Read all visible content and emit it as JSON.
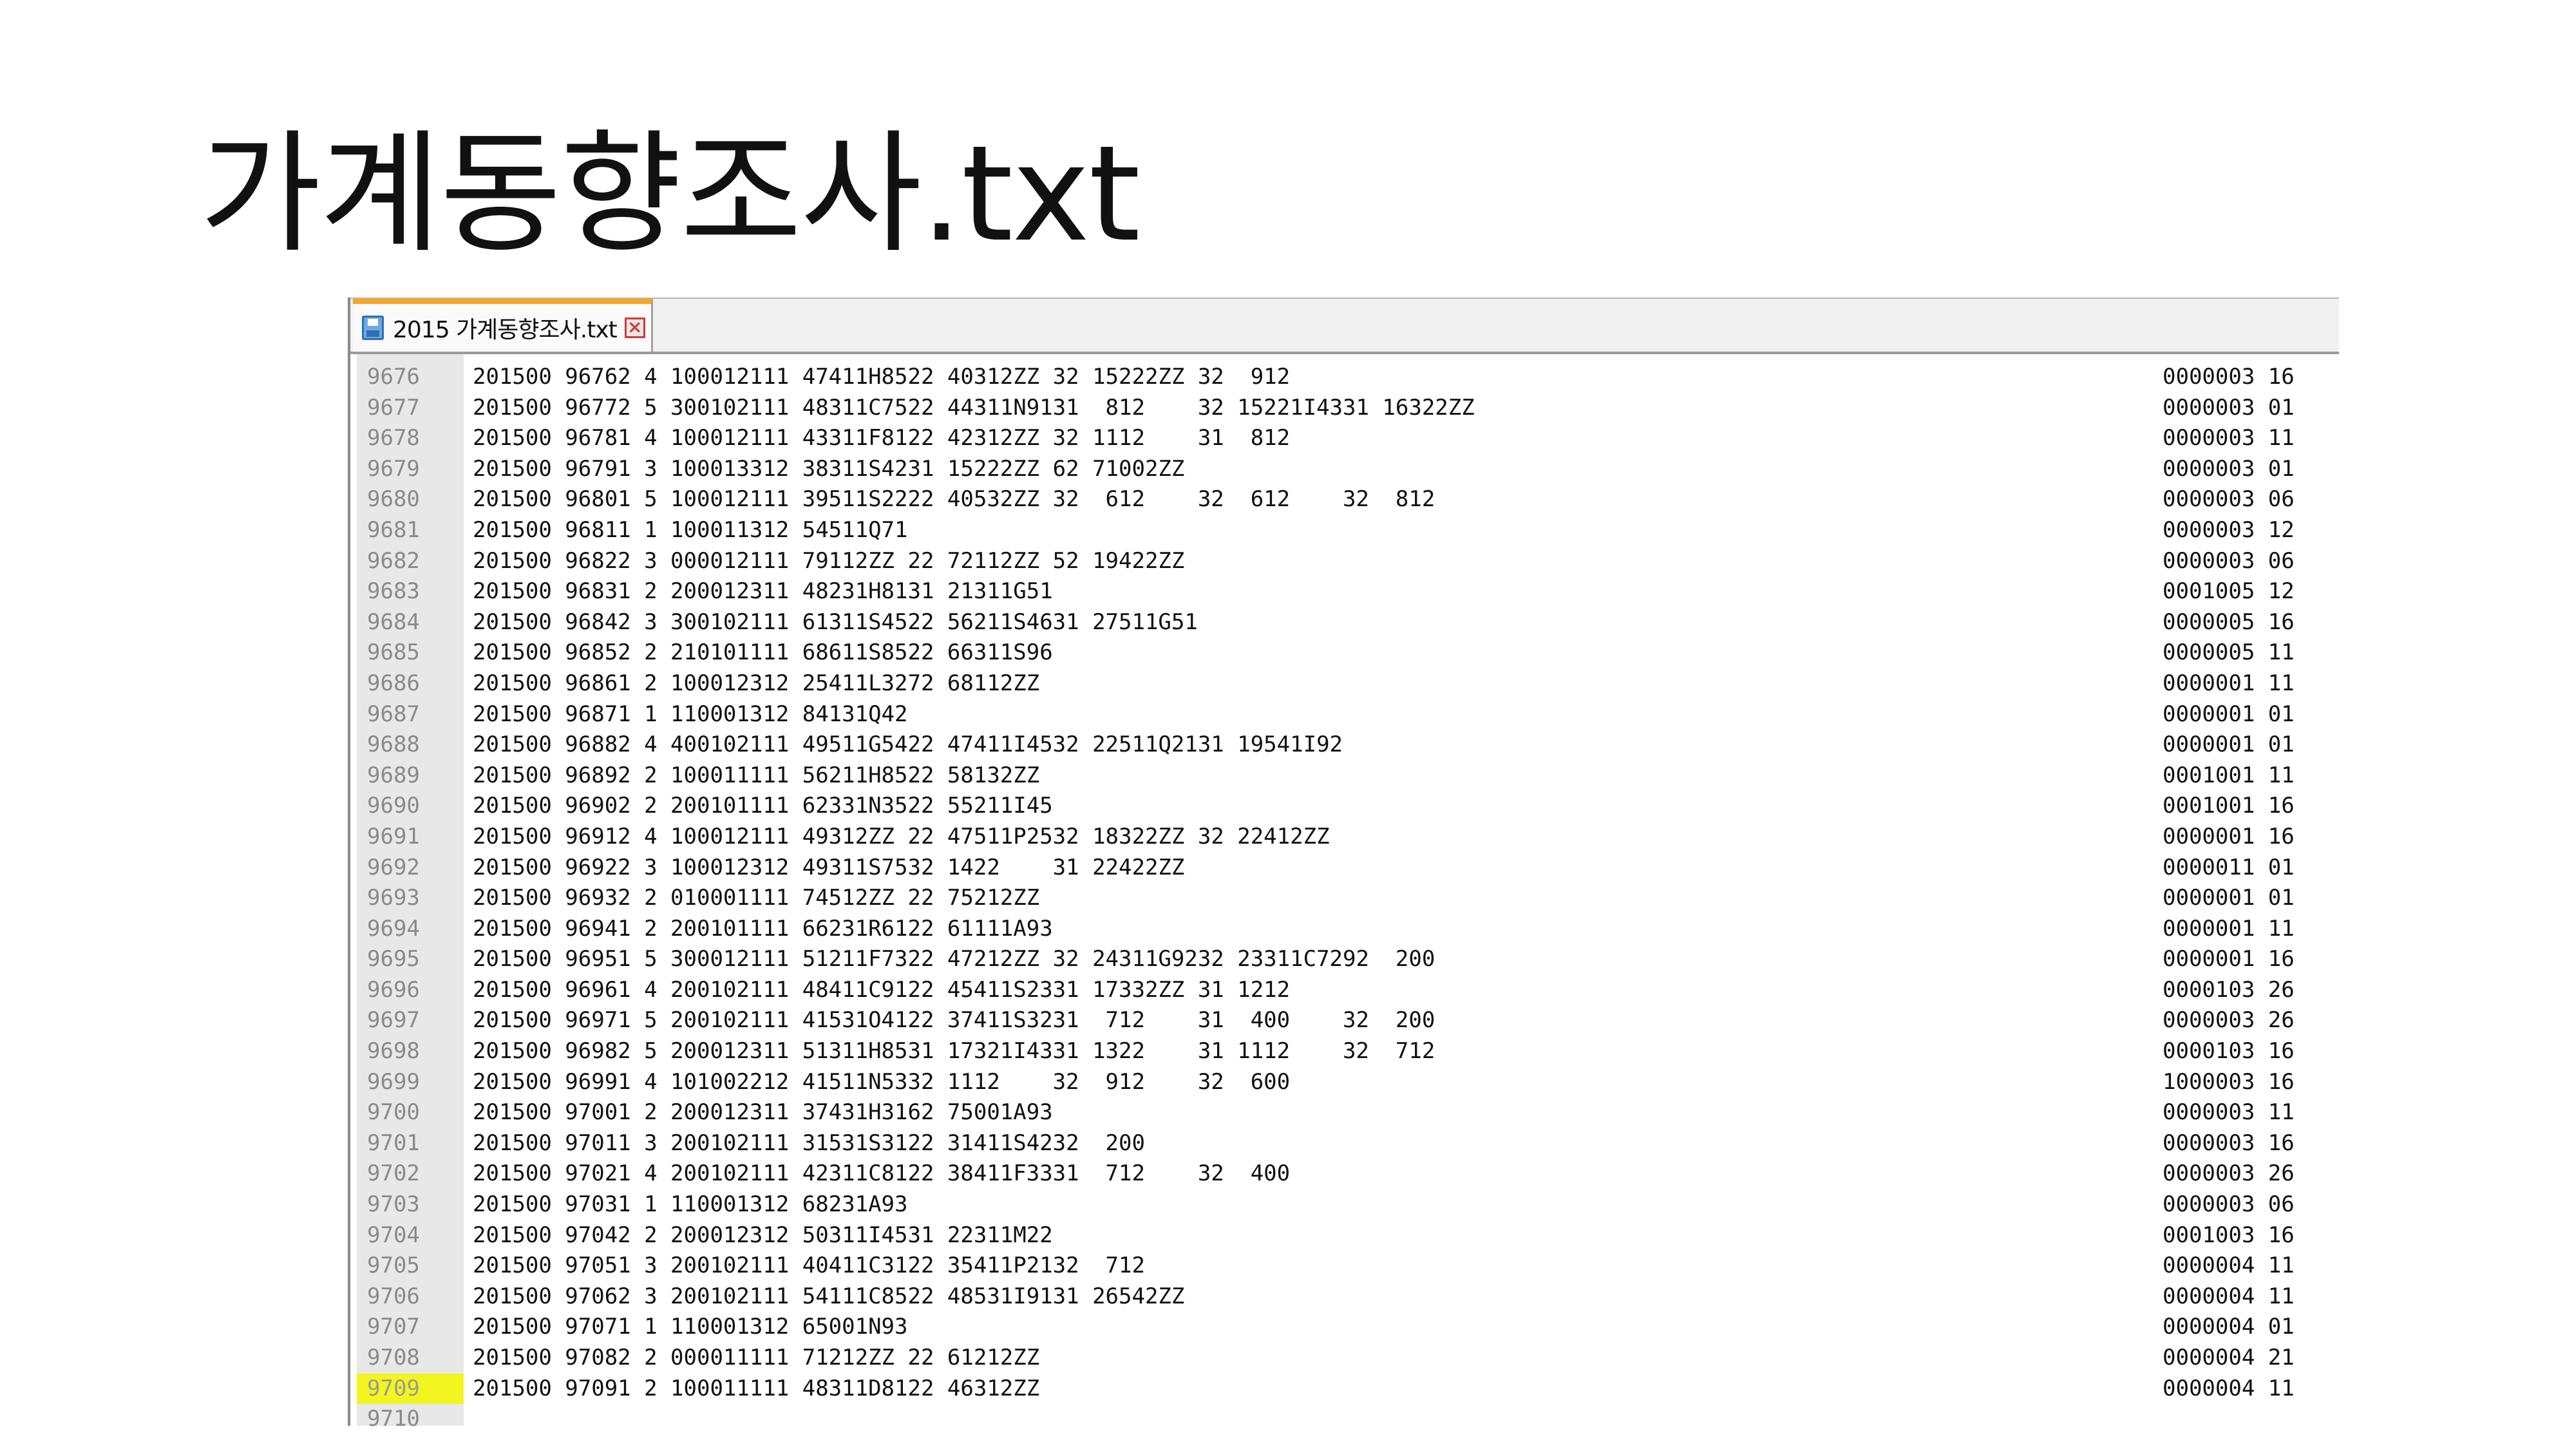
{
  "slide": {
    "title": "가계동향조사.txt"
  },
  "tab": {
    "label": "2015 가계동향조사.txt",
    "icon": "save-icon",
    "close_icon": "close-icon"
  },
  "highlight_color": "#f2f520",
  "lines": [
    {
      "n": "9676",
      "text": "201500 96762 4 100012111 47411H8522 40312ZZ 32 15222ZZ 32  912",
      "tail": "0000003 16"
    },
    {
      "n": "9677",
      "text": "201500 96772 5 300102111 48311C7522 44311N9131  812    32 15221I4331 16322ZZ",
      "tail": "0000003 01"
    },
    {
      "n": "9678",
      "text": "201500 96781 4 100012111 43311F8122 42312ZZ 32 1112    31  812",
      "tail": "0000003 11"
    },
    {
      "n": "9679",
      "text": "201500 96791 3 100013312 38311S4231 15222ZZ 62 71002ZZ",
      "tail": "0000003 01"
    },
    {
      "n": "9680",
      "text": "201500 96801 5 100012111 39511S2222 40532ZZ 32  612    32  612    32  812",
      "tail": "0000003 06"
    },
    {
      "n": "9681",
      "text": "201500 96811 1 100011312 54511Q71",
      "tail": "0000003 12"
    },
    {
      "n": "9682",
      "text": "201500 96822 3 000012111 79112ZZ 22 72112ZZ 52 19422ZZ",
      "tail": "0000003 06"
    },
    {
      "n": "9683",
      "text": "201500 96831 2 200012311 48231H8131 21311G51",
      "tail": "0001005 12"
    },
    {
      "n": "9684",
      "text": "201500 96842 3 300102111 61311S4522 56211S4631 27511G51",
      "tail": "0000005 16"
    },
    {
      "n": "9685",
      "text": "201500 96852 2 210101111 68611S8522 66311S96",
      "tail": "0000005 11"
    },
    {
      "n": "9686",
      "text": "201500 96861 2 100012312 25411L3272 68112ZZ",
      "tail": "0000001 11"
    },
    {
      "n": "9687",
      "text": "201500 96871 1 110001312 84131Q42",
      "tail": "0000001 01"
    },
    {
      "n": "9688",
      "text": "201500 96882 4 400102111 49511G5422 47411I4532 22511Q2131 19541I92",
      "tail": "0000001 01"
    },
    {
      "n": "9689",
      "text": "201500 96892 2 100011111 56211H8522 58132ZZ",
      "tail": "0001001 11"
    },
    {
      "n": "9690",
      "text": "201500 96902 2 200101111 62331N3522 55211I45",
      "tail": "0001001 16"
    },
    {
      "n": "9691",
      "text": "201500 96912 4 100012111 49312ZZ 22 47511P2532 18322ZZ 32 22412ZZ",
      "tail": "0000001 16"
    },
    {
      "n": "9692",
      "text": "201500 96922 3 100012312 49311S7532 1422    31 22422ZZ",
      "tail": "0000011 01"
    },
    {
      "n": "9693",
      "text": "201500 96932 2 010001111 74512ZZ 22 75212ZZ",
      "tail": "0000001 01"
    },
    {
      "n": "9694",
      "text": "201500 96941 2 200101111 66231R6122 61111A93",
      "tail": "0000001 11"
    },
    {
      "n": "9695",
      "text": "201500 96951 5 300012111 51211F7322 47212ZZ 32 24311G9232 23311C7292  200",
      "tail": "0000001 16"
    },
    {
      "n": "9696",
      "text": "201500 96961 4 200102111 48411C9122 45411S2331 17332ZZ 31 1212",
      "tail": "0000103 26"
    },
    {
      "n": "9697",
      "text": "201500 96971 5 200102111 41531O4122 37411S3231  712    31  400    32  200",
      "tail": "0000003 26"
    },
    {
      "n": "9698",
      "text": "201500 96982 5 200012311 51311H8531 17321I4331 1322    31 1112    32  712",
      "tail": "0000103 16"
    },
    {
      "n": "9699",
      "text": "201500 96991 4 101002212 41511N5332 1112    32  912    32  600",
      "tail": "1000003 16"
    },
    {
      "n": "9700",
      "text": "201500 97001 2 200012311 37431H3162 75001A93",
      "tail": "0000003 11"
    },
    {
      "n": "9701",
      "text": "201500 97011 3 200102111 31531S3122 31411S4232  200",
      "tail": "0000003 16"
    },
    {
      "n": "9702",
      "text": "201500 97021 4 200102111 42311C8122 38411F3331  712    32  400",
      "tail": "0000003 26"
    },
    {
      "n": "9703",
      "text": "201500 97031 1 110001312 68231A93",
      "tail": "0000003 06"
    },
    {
      "n": "9704",
      "text": "201500 97042 2 200012312 50311I4531 22311M22",
      "tail": "0001003 16"
    },
    {
      "n": "9705",
      "text": "201500 97051 3 200102111 40411C3122 35411P2132  712",
      "tail": "0000004 11"
    },
    {
      "n": "9706",
      "text": "201500 97062 3 200102111 54111C8522 48531I9131 26542ZZ",
      "tail": "0000004 11"
    },
    {
      "n": "9707",
      "text": "201500 97071 1 110001312 65001N93",
      "tail": "0000004 01"
    },
    {
      "n": "9708",
      "text": "201500 97082 2 000011111 71212ZZ 22 61212ZZ",
      "tail": "0000004 21"
    },
    {
      "n": "9709",
      "text": "201500 97091 2 100011111 48311D8122 46312ZZ",
      "tail": "0000004 11",
      "highlight": true
    },
    {
      "n": "9710",
      "text": "",
      "tail": ""
    }
  ]
}
